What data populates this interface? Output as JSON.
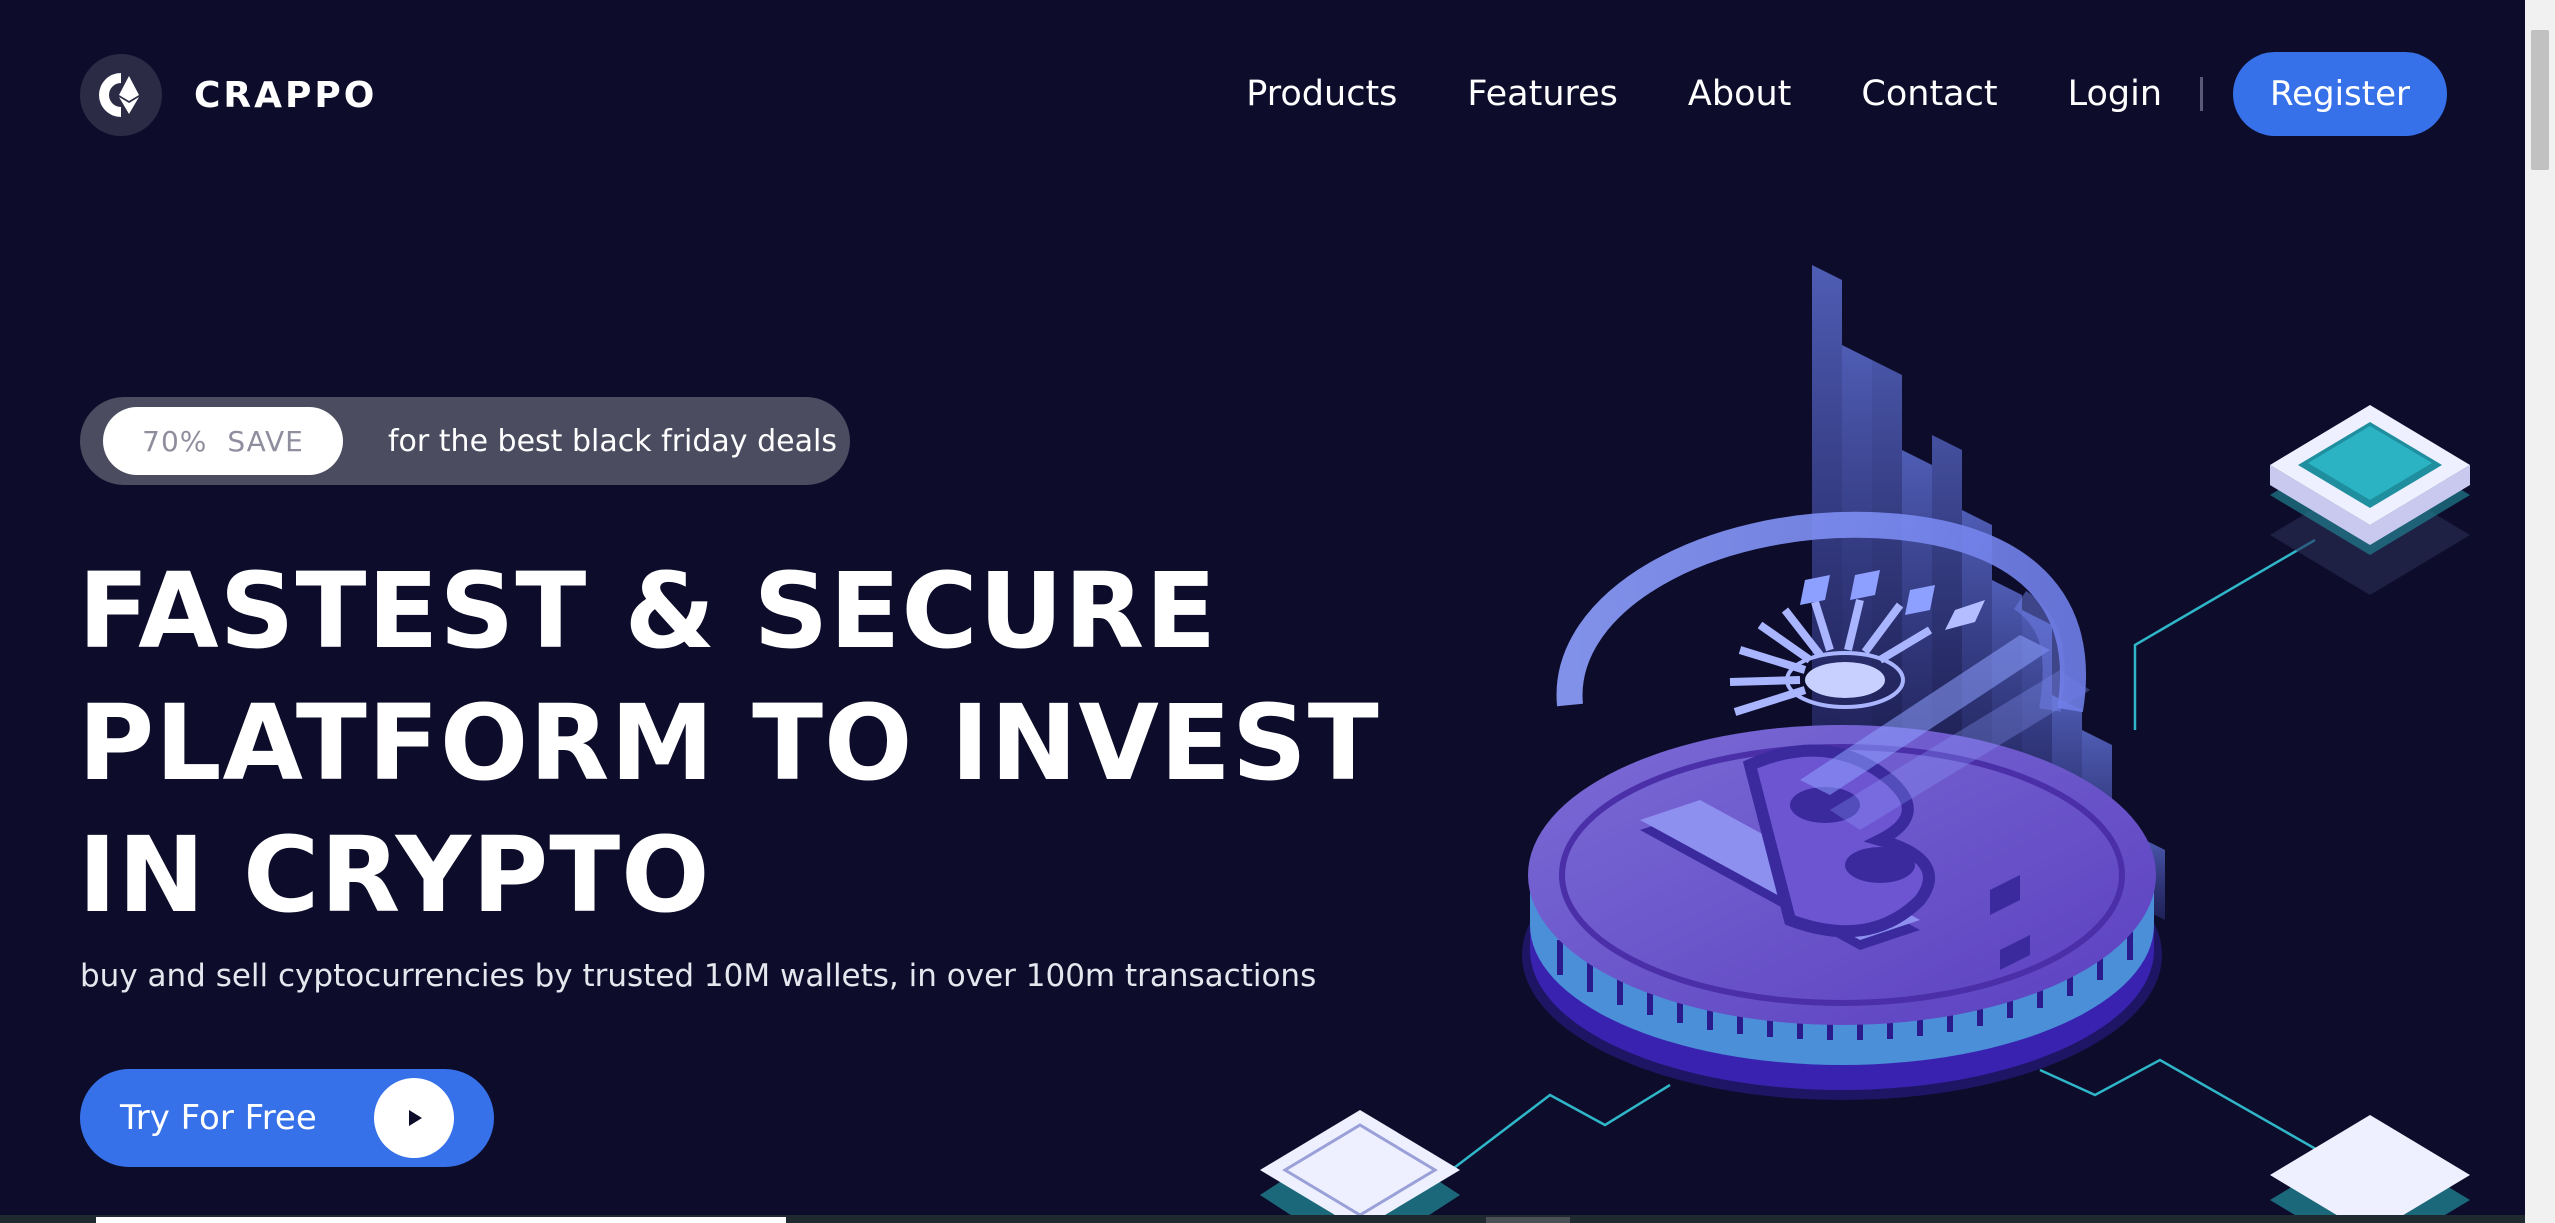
{
  "brand": {
    "name": "CRAPPO",
    "logo_icon": "ethereum-logo-icon"
  },
  "nav": {
    "items": [
      {
        "label": "Products"
      },
      {
        "label": "Features"
      },
      {
        "label": "About"
      },
      {
        "label": "Contact"
      },
      {
        "label": "Login"
      }
    ],
    "register_label": "Register"
  },
  "promo": {
    "percent": "70%",
    "save": "SAVE",
    "text": "for the best black friday deals"
  },
  "hero": {
    "headline_lines": [
      "FASTEST & SECURE",
      "PLATFORM TO INVEST",
      "IN CRYPTO"
    ],
    "subtext": "buy and sell cyptocurrencies by trusted 10M wallets, in over 100m transactions",
    "cta_label": "Try For Free",
    "cta_icon": "play-icon"
  },
  "illustration": {
    "name": "isometric-bitcoin-coin-illustration"
  },
  "colors": {
    "background": "#0d0d2b",
    "accent": "#3671e9",
    "promo_pill": "#4b4c60"
  }
}
